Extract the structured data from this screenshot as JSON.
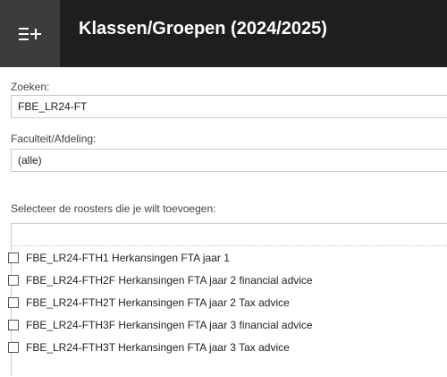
{
  "header": {
    "title": "Klassen/Groepen (2024/2025)",
    "menu_icon": "menu-plus-icon"
  },
  "search": {
    "label": "Zoeken:",
    "value": "FBE_LR24-FT"
  },
  "faculty": {
    "label": "Faculteit/Afdeling:",
    "value": "(alle)"
  },
  "schedules": {
    "label": "Selecteer de roosters die je wilt toevoegen:",
    "filter_value": "",
    "items": [
      {
        "label": "FBE_LR24-FTH1 Herkansingen FTA jaar 1",
        "checked": false
      },
      {
        "label": "FBE_LR24-FTH2F Herkansingen FTA jaar 2 financial advice",
        "checked": false
      },
      {
        "label": "FBE_LR24-FTH2T Herkansingen FTA jaar 2 Tax advice",
        "checked": false
      },
      {
        "label": "FBE_LR24-FTH3F Herkansingen FTA jaar 3 financial advice",
        "checked": false
      },
      {
        "label": "FBE_LR24-FTH3T Herkansingen FTA jaar 3 Tax advice",
        "checked": false
      }
    ]
  }
}
